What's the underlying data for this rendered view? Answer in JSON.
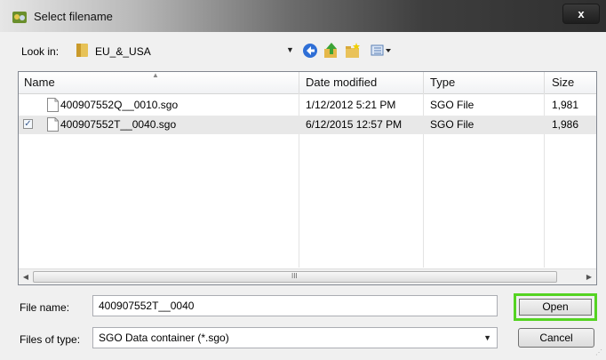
{
  "window": {
    "title": "Select filename",
    "close_glyph": "x"
  },
  "look_in": {
    "label": "Look in:",
    "value": "EU_&_USA",
    "icon": "folder-icon"
  },
  "toolbar": {
    "icons": [
      "back-icon",
      "up-folder-icon",
      "new-folder-icon",
      "view-menu-icon"
    ]
  },
  "list": {
    "columns": [
      "Name",
      "Date modified",
      "Type",
      "Size"
    ],
    "rows": [
      {
        "name": "400907552Q__0010.sgo",
        "date": "1/12/2012 5:21 PM",
        "type": "SGO File",
        "size": "1,981",
        "checked": false,
        "selected": false
      },
      {
        "name": "400907552T__0040.sgo",
        "date": "6/12/2015 12:57 PM",
        "type": "SGO File",
        "size": "1,986",
        "checked": true,
        "selected": true
      }
    ],
    "scroll_grip": "III"
  },
  "file_name": {
    "label": "File name:",
    "value": "400907552T__0040"
  },
  "files_of_type": {
    "label": "Files of type:",
    "value": "SGO Data container (*.sgo)"
  },
  "buttons": {
    "open": "Open",
    "cancel": "Cancel"
  },
  "colors": {
    "highlight": "#55d322",
    "selection": "#e8e8e8"
  }
}
